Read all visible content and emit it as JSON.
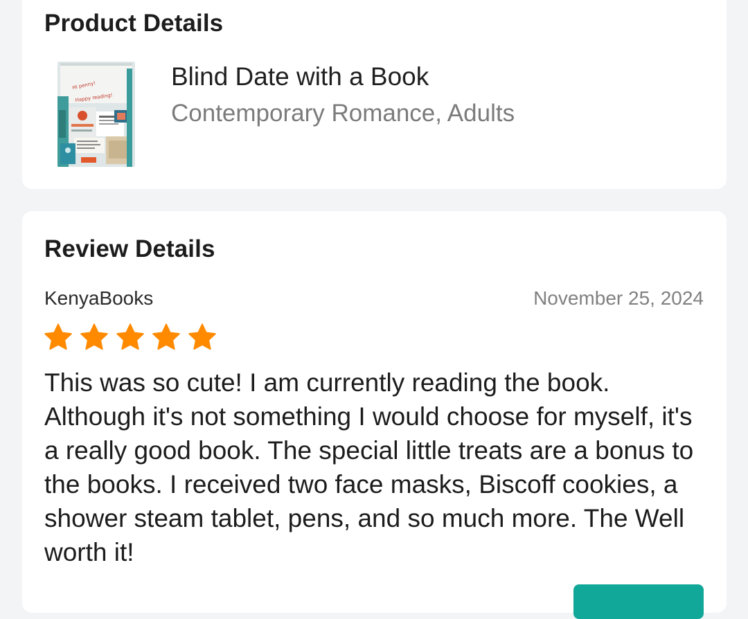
{
  "product_section": {
    "title": "Product Details",
    "product": {
      "name": "Blind Date with a Book",
      "subtitle": "Contemporary Romance, Adults",
      "thumbnail_icon": "product-photo"
    }
  },
  "review_section": {
    "title": "Review Details",
    "reviewer": "KenyaBooks",
    "date": "November 25, 2024",
    "rating": 5,
    "rating_max": 5,
    "text": "This was so cute! I am currently reading the book. Although it's not something I would choose for myself, it's a really good book. The special little treats are a bonus to the books. I received two face masks, Biscoff cookies, a shower steam tablet, pens, and so much more. The Well worth it!"
  },
  "colors": {
    "star": "#ff8a00",
    "accent": "#12a899",
    "background": "#f3f4f6",
    "card": "#ffffff"
  }
}
